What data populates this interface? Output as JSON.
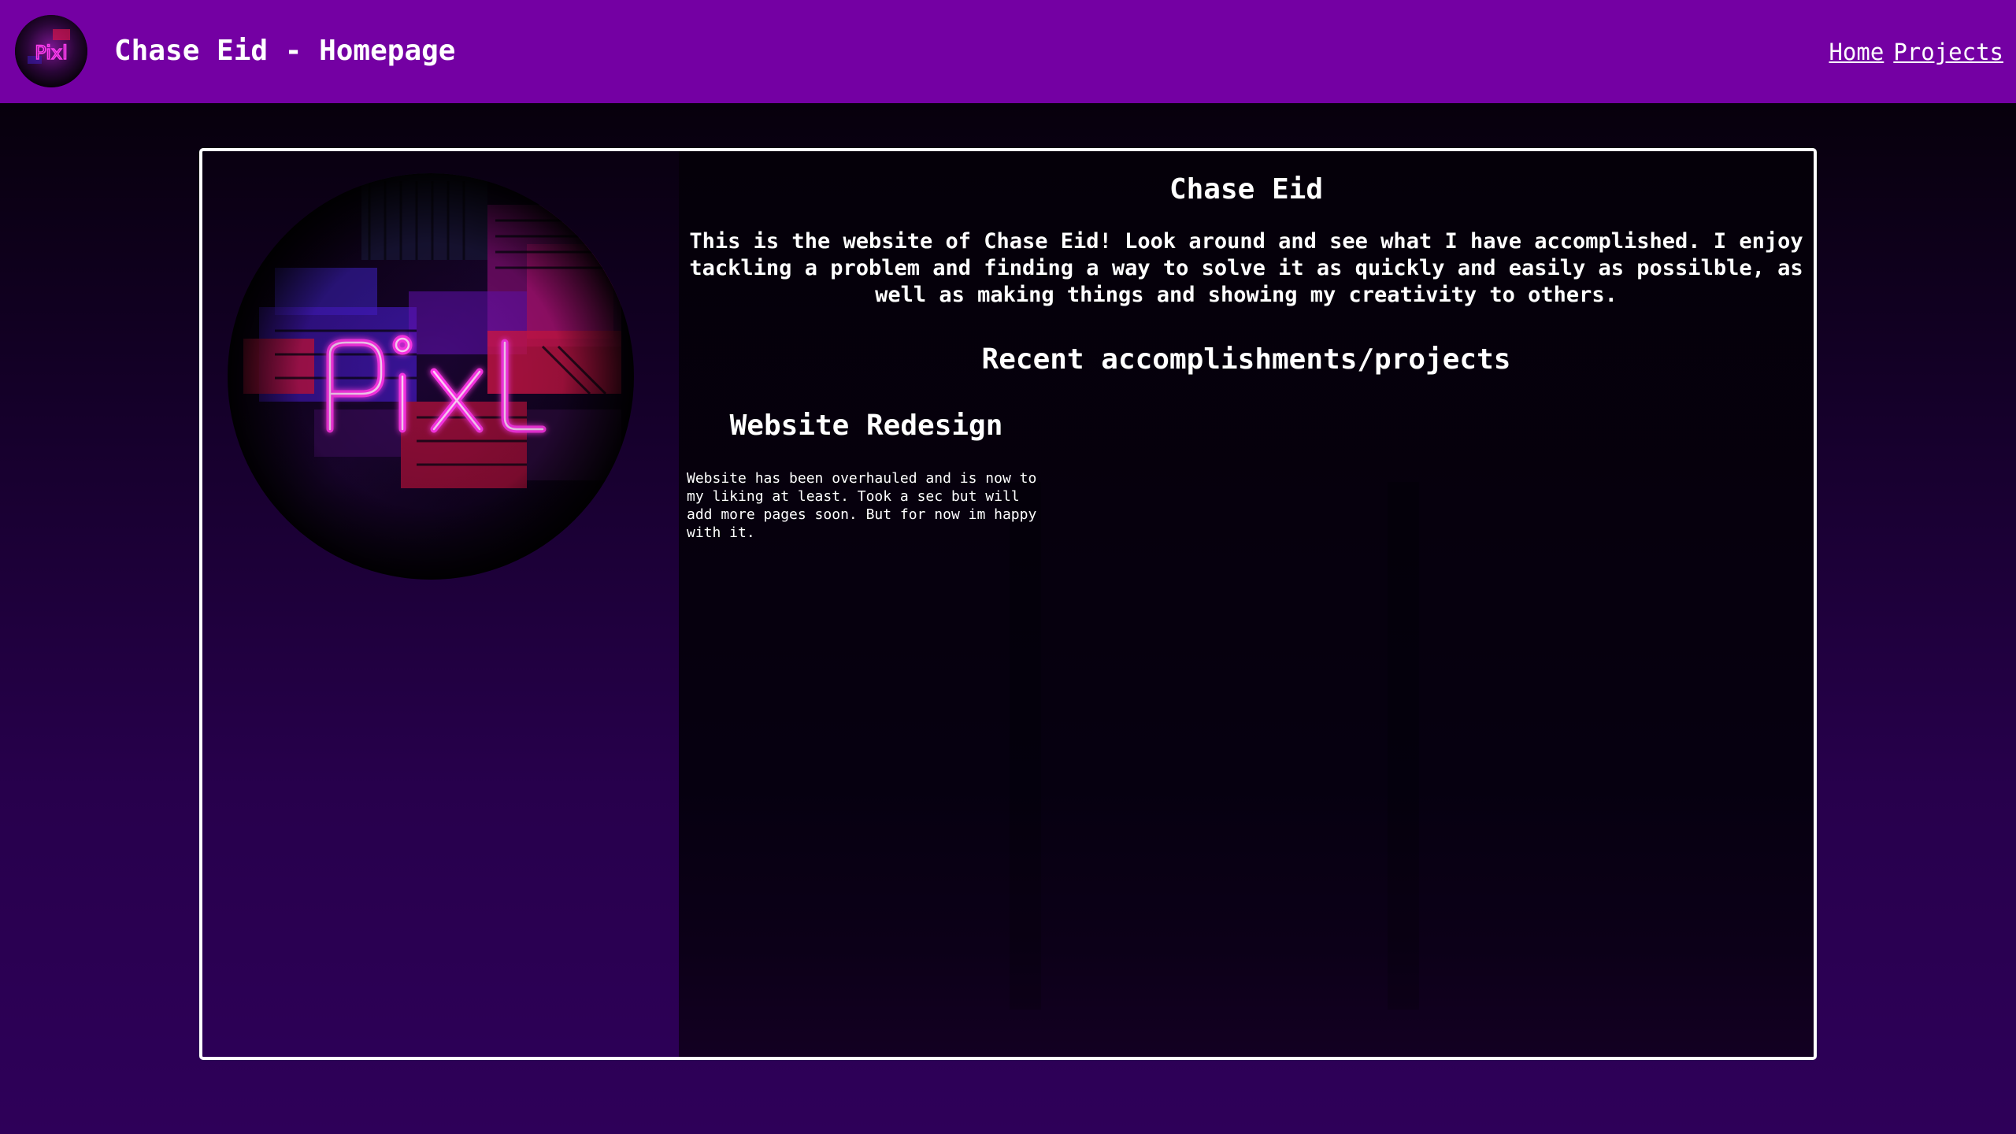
{
  "navbar": {
    "title": "Chase Eid - Homepage",
    "logo_text": "Pixl",
    "links": [
      "Home",
      "Projects"
    ]
  },
  "main": {
    "heading": "Chase Eid",
    "intro": "This is the website of Chase Eid! Look around and see what I have accomplished. I enjoy tackling a problem and finding a way to solve it as quickly and easily as possilble, as well as making things and showing my creativity to others.",
    "section_heading": "Recent accomplishments/projects",
    "hero_logo_text": "Pixl",
    "projects": [
      {
        "title": "Website Redesign",
        "description": "Website has been overhauled and is now to my liking at least. Took a sec but will add more pages soon. But for now im happy with it."
      }
    ]
  },
  "colors": {
    "navbar": "#7400a3",
    "page_dark": "#07000c",
    "page_bottom": "#2e0059",
    "neon_pink": "#ff2bd6",
    "box_border": "#ffffff"
  }
}
